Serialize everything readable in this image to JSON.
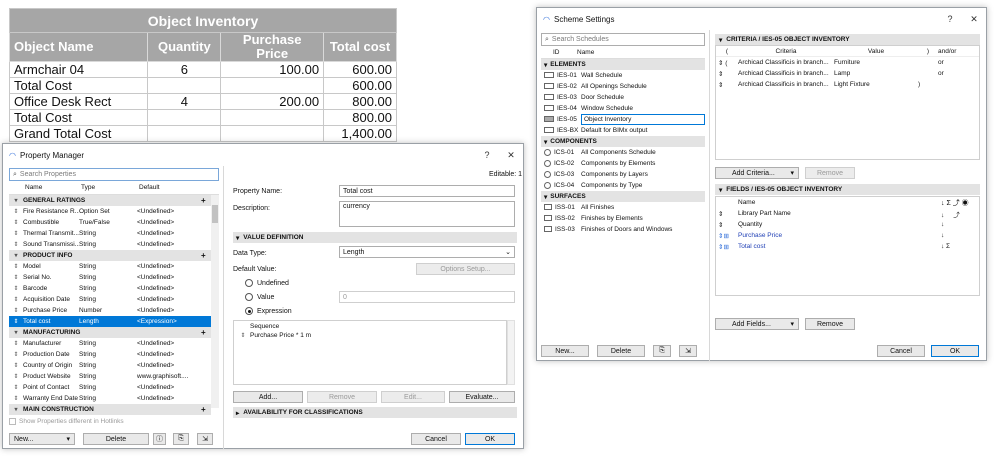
{
  "inventory": {
    "title": "Object Inventory",
    "headers": [
      "Object Name",
      "Quantity",
      "Purchase Price",
      "Total cost"
    ],
    "rows": [
      {
        "name": "Armchair 04",
        "qty": "6",
        "price": "100.00",
        "total": "600.00"
      },
      {
        "name": "Total Cost",
        "qty": "",
        "price": "",
        "total": "600.00"
      },
      {
        "name": "Office Desk Rect",
        "qty": "4",
        "price": "200.00",
        "total": "800.00"
      },
      {
        "name": "Total Cost",
        "qty": "",
        "price": "",
        "total": "800.00"
      },
      {
        "name": "Grand Total Cost",
        "qty": "",
        "price": "",
        "total": "1,400.00"
      }
    ]
  },
  "property_manager": {
    "title": "Property Manager",
    "help": "?",
    "close": "✕",
    "search_placeholder": "Search Properties",
    "columns": [
      "Name",
      "Type",
      "Default"
    ],
    "groups": [
      {
        "name": "GENERAL RATINGS",
        "items": [
          {
            "name": "Fire Resistance R...",
            "type": "Option Set",
            "default": "<Undefined>"
          },
          {
            "name": "Combustible",
            "type": "True/False",
            "default": "<Undefined>"
          },
          {
            "name": "Thermal Transmit...",
            "type": "String",
            "default": "<Undefined>"
          },
          {
            "name": "Sound Transmissi...",
            "type": "String",
            "default": "<Undefined>"
          }
        ]
      },
      {
        "name": "PRODUCT INFO",
        "items": [
          {
            "name": "Model",
            "type": "String",
            "default": "<Undefined>"
          },
          {
            "name": "Serial No.",
            "type": "String",
            "default": "<Undefined>"
          },
          {
            "name": "Barcode",
            "type": "String",
            "default": "<Undefined>"
          },
          {
            "name": "Acquisition Date",
            "type": "String",
            "default": "<Undefined>"
          },
          {
            "name": "Purchase Price",
            "type": "Number",
            "default": "<Undefined>"
          },
          {
            "name": "Total cost",
            "type": "Length",
            "default": "<Expression>",
            "selected": true
          }
        ]
      },
      {
        "name": "MANUFACTURING",
        "items": [
          {
            "name": "Manufacturer",
            "type": "String",
            "default": "<Undefined>"
          },
          {
            "name": "Production Date",
            "type": "String",
            "default": "<Undefined>"
          },
          {
            "name": "Country of Origin",
            "type": "String",
            "default": "<Undefined>"
          },
          {
            "name": "Product Website",
            "type": "String",
            "default": "www.graphisoft...."
          },
          {
            "name": "Point of Contact",
            "type": "String",
            "default": "<Undefined>"
          },
          {
            "name": "Warranty End Date",
            "type": "String",
            "default": "<Undefined>"
          }
        ]
      },
      {
        "name": "MAIN CONSTRUCTION",
        "items": []
      }
    ],
    "show_hotlinks": "Show Properties different in Hotlinks",
    "new_btn": "New...",
    "delete_btn": "Delete",
    "editable": "Editable: 1",
    "property_name_label": "Property Name:",
    "property_name_value": "Total cost",
    "description_label": "Description:",
    "description_value": "currency",
    "value_def_header": "VALUE DEFINITION",
    "data_type_label": "Data Type:",
    "data_type_value": "Length",
    "default_value_label": "Default Value:",
    "options_setup": "Options Setup...",
    "opt_undefined": "Undefined",
    "opt_value": "Value",
    "opt_value_field": "0",
    "opt_expression": "Expression",
    "sequence_label": "Sequence",
    "sequence_item": "Purchase Price * 1 m",
    "add_btn": "Add...",
    "remove_btn": "Remove",
    "edit_btn": "Edit...",
    "evaluate_btn": "Evaluate...",
    "availability_header": "AVAILABILITY FOR CLASSIFICATIONS",
    "cancel_btn": "Cancel",
    "ok_btn": "OK"
  },
  "scheme_settings": {
    "title": "Scheme Settings",
    "help": "?",
    "close": "✕",
    "search_placeholder": "Search Schedules",
    "columns": [
      "ID",
      "Name"
    ],
    "groups": [
      {
        "name": "ELEMENTS",
        "items": [
          {
            "id": "IES-01",
            "name": "Wall Schedule"
          },
          {
            "id": "IES-02",
            "name": "All Openings Schedule"
          },
          {
            "id": "IES-03",
            "name": "Door Schedule"
          },
          {
            "id": "IES-04",
            "name": "Window Schedule"
          },
          {
            "id": "IES-05",
            "name": "Object Inventory",
            "selected": true
          },
          {
            "id": "IES-BX",
            "name": "Default for BIMx output"
          }
        ]
      },
      {
        "name": "COMPONENTS",
        "items": [
          {
            "id": "ICS-01",
            "name": "All Components Schedule"
          },
          {
            "id": "ICS-02",
            "name": "Components by Elements"
          },
          {
            "id": "ICS-03",
            "name": "Components by Layers"
          },
          {
            "id": "ICS-04",
            "name": "Components by Type"
          }
        ]
      },
      {
        "name": "SURFACES",
        "items": [
          {
            "id": "ISS-01",
            "name": "All Finishes"
          },
          {
            "id": "ISS-02",
            "name": "Finishes by Elements"
          },
          {
            "id": "ISS-03",
            "name": "Finishes of Doors and Windows"
          }
        ]
      }
    ],
    "new_btn": "New...",
    "delete_btn": "Delete",
    "criteria_header": "CRITERIA / IES-05 OBJECT INVENTORY",
    "criteria_columns": [
      "(",
      "Criteria",
      "Value",
      ")",
      "and/or"
    ],
    "criteria_rows": [
      {
        "open": "(",
        "criteria": "Archicad Classificat...",
        "op": "is in branch...",
        "value": "Furniture",
        "close": "",
        "andor": "or"
      },
      {
        "open": "",
        "criteria": "Archicad Classificat...",
        "op": "is in branch...",
        "value": "Lamp",
        "close": "",
        "andor": "or"
      },
      {
        "open": "",
        "criteria": "Archicad Classificat...",
        "op": "is in branch...",
        "value": "Light Fixture",
        "close": ")",
        "andor": ""
      }
    ],
    "add_criteria_btn": "Add Criteria...",
    "remove_btn": "Remove",
    "fields_header": "FIELDS / IES-05 OBJECT INVENTORY",
    "fields_column": "Name",
    "fields": [
      {
        "name": "Library Part Name",
        "link": false,
        "sum": false
      },
      {
        "name": "Quantity",
        "link": false,
        "sum": false
      },
      {
        "name": "Purchase Price",
        "link": true,
        "sum": false
      },
      {
        "name": "Total cost",
        "link": true,
        "sum": true
      }
    ],
    "add_fields_btn": "Add Fields...",
    "cancel_btn": "Cancel",
    "ok_btn": "OK"
  }
}
